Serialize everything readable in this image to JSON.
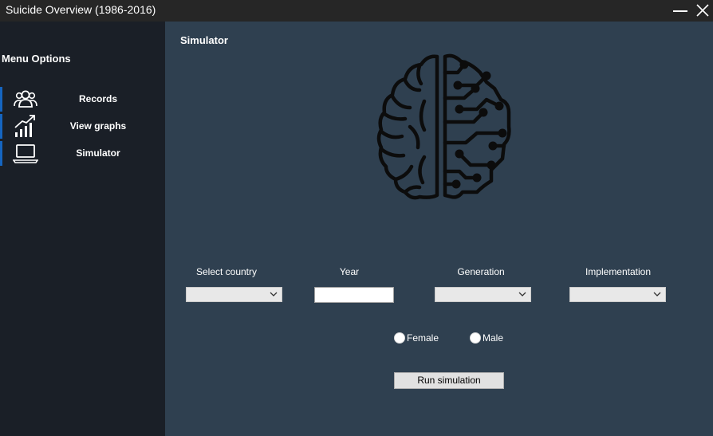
{
  "window": {
    "title": "Suicide Overview (1986-2016)"
  },
  "sidebar": {
    "heading": "Menu Options",
    "accent_color": "#1565c0",
    "items": [
      {
        "label": "Records",
        "icon": "users-icon"
      },
      {
        "label": "View graphs",
        "icon": "growth-chart-icon"
      },
      {
        "label": "Simulator",
        "icon": "laptop-icon"
      }
    ]
  },
  "main": {
    "title": "Simulator",
    "illustration": "brain-circuit-icon",
    "fields": {
      "country_label": "Select country",
      "country_value": "",
      "year_label": "Year",
      "year_value": "",
      "generation_label": "Generation",
      "generation_value": "",
      "implementation_label": "Implementation",
      "implementation_value": ""
    },
    "gender": {
      "female_label": "Female",
      "male_label": "Male"
    },
    "run_button": "Run simulation"
  }
}
